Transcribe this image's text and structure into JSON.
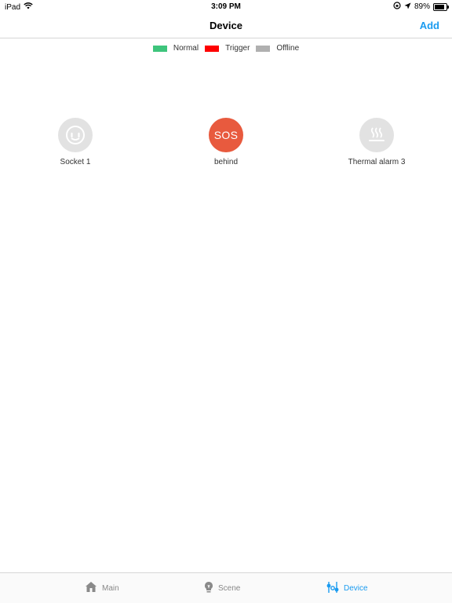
{
  "status_bar": {
    "device": "iPad",
    "time": "3:09 PM",
    "battery": "89%",
    "battery_level": 0.89
  },
  "navbar": {
    "title": "Device",
    "add_label": "Add"
  },
  "legend": [
    {
      "label": "Normal",
      "color": "#3ec47c"
    },
    {
      "label": "Trigger",
      "color": "#fe0000"
    },
    {
      "label": "Offline",
      "color": "#b0b0b0"
    }
  ],
  "devices": [
    {
      "label": "Socket 1",
      "status": "offline",
      "icon": "socket-icon"
    },
    {
      "label": "behind",
      "status": "trigger",
      "icon": "sos-icon",
      "badge": "SOS"
    },
    {
      "label": "Thermal alarm 3",
      "status": "offline",
      "icon": "heat-icon"
    }
  ],
  "tabbar": {
    "tabs": [
      {
        "label": "Main",
        "icon": "home-icon",
        "active": false
      },
      {
        "label": "Scene",
        "icon": "lightbulb-icon",
        "active": false
      },
      {
        "label": "Device",
        "icon": "sliders-icon",
        "active": true
      }
    ]
  },
  "colors": {
    "accent": "#1a9bf0",
    "offline_bg": "#e2e2e2",
    "trigger_bg": "#e85a3e"
  }
}
